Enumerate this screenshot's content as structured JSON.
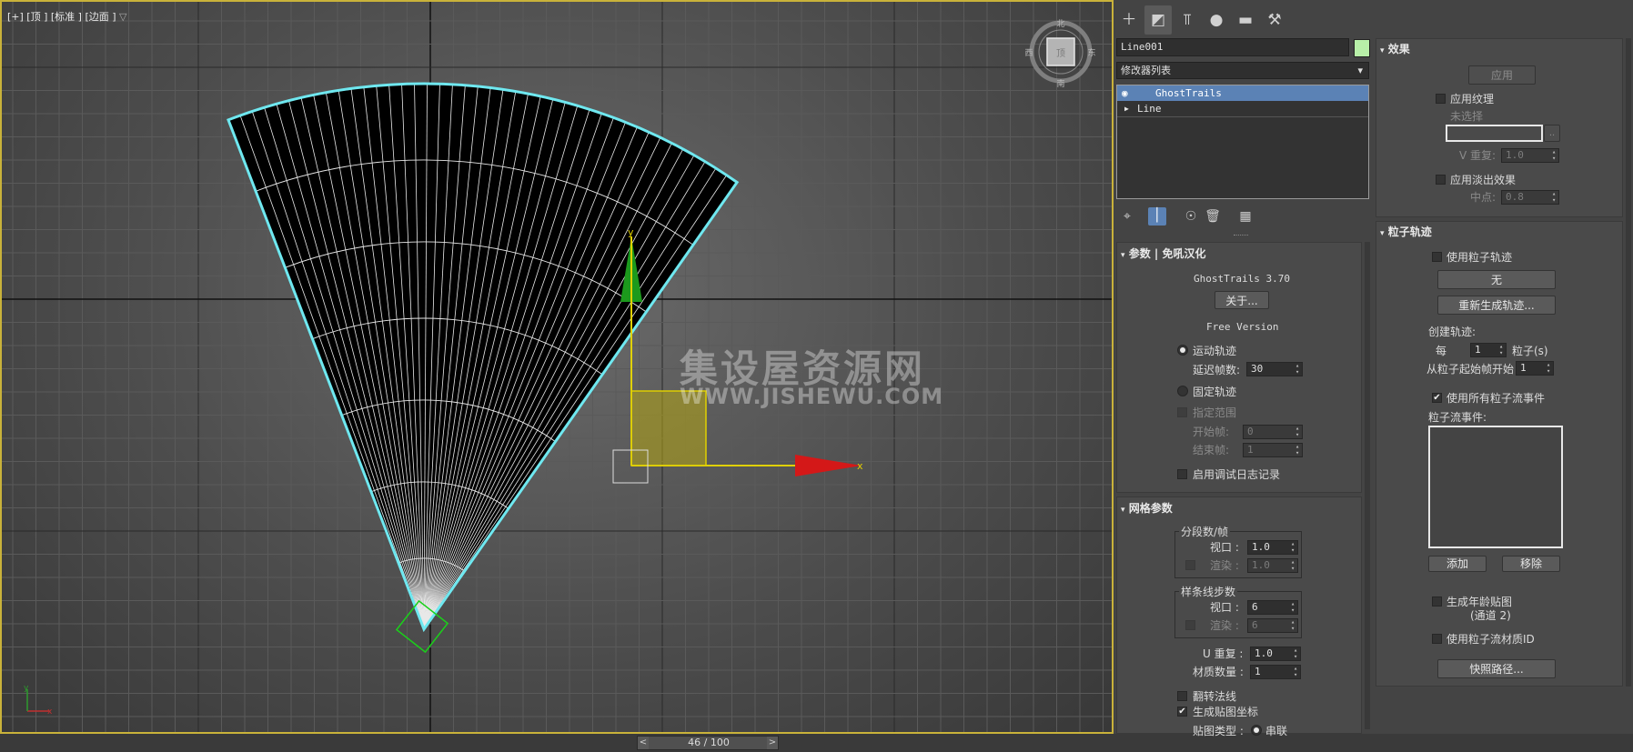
{
  "viewport": {
    "label": "[+] [顶 ] [标准 ] [边面 ]",
    "filter_icon": "filter-icon",
    "viewcube": {
      "top": "北",
      "left": "西",
      "right": "东",
      "bottom": "南",
      "face": "顶"
    },
    "axis_labels": {
      "x": "x",
      "y": "y"
    },
    "watermark_cn": "集设屋资源网",
    "watermark_url": "WWW.JISHEWU.COM"
  },
  "timebar": {
    "frame_text": "46 / 100",
    "prev": "<",
    "next": ">"
  },
  "command_tabs": [
    "create-icon",
    "modify-icon",
    "hierarchy-icon",
    "motion-icon",
    "display-icon",
    "utilities-icon"
  ],
  "object": {
    "name": "Line001",
    "color": "#b8f0a8"
  },
  "modifier_list": {
    "label": "修改器列表",
    "arrow": "▾"
  },
  "stack": {
    "items": [
      {
        "label": "GhostTrails",
        "selected": true
      },
      {
        "label": "Line",
        "selected": false
      }
    ]
  },
  "stack_tools": [
    "pin-icon",
    "show-end-result-icon",
    "make-unique-icon",
    "remove-modifier-icon",
    "configure-icon"
  ],
  "params": {
    "header": "参数 | 免吼汉化",
    "version": "GhostTrails 3.70",
    "about_btn": "关于...",
    "edition": "Free Version",
    "motion_trail": "运动轨迹",
    "delay_frames_label": "延迟帧数:",
    "delay_frames_value": "30",
    "fixed_trail": "固定轨迹",
    "specify_range": "指定范围",
    "start_frame_label": "开始帧:",
    "start_frame_value": "0",
    "end_frame_label": "结束帧:",
    "end_frame_value": "1",
    "debug_log": "启用调试日志记录"
  },
  "mesh": {
    "header": "网格参数",
    "segments_group": "分段数/帧",
    "viewport_label": "视口 :",
    "viewport_segments": "1.0",
    "render_label": "渲染 :",
    "render_segments": "1.0",
    "spline_group": "样条线步数",
    "spline_viewport": "6",
    "spline_render": "6",
    "u_repeat_label": "U 重复 :",
    "u_repeat_value": "1.0",
    "mat_count_label": "材质数量 :",
    "mat_count_value": "1",
    "flip_normals": "翻转法线",
    "gen_mapping": "生成贴图坐标",
    "map_type_label": "贴图类型 :",
    "map_type_value": "串联"
  },
  "effects": {
    "header": "效果",
    "apply_btn": "应用",
    "apply_texture": "应用纹理",
    "none_selected": "未选择",
    "v_repeat_label": "V 重复:",
    "v_repeat_value": "1.0",
    "apply_fade": "应用淡出效果",
    "midpoint_label": "中点:",
    "midpoint_value": "0.8"
  },
  "particles": {
    "header": "粒子轨迹",
    "use_particle_trail": "使用粒子轨迹",
    "none_btn": "无",
    "regen_btn": "重新生成轨迹...",
    "create_trail_label": "创建轨迹:",
    "every_label": "每",
    "every_value": "1",
    "particles_unit": "粒子(s)",
    "start_from_label": "从粒子起始帧开始",
    "start_from_value": "1",
    "use_all_events": "使用所有粒子流事件",
    "events_label": "粒子流事件:",
    "add_btn": "添加",
    "remove_btn": "移除",
    "gen_age_map": "生成年龄贴图",
    "channel_label": "(通道 2)",
    "use_mat_id": "使用粒子流材质ID",
    "snapshot_btn": "快照路径..."
  },
  "colors": {
    "selection_cyan": "#6fe8f0",
    "gizmo_green": "#1ad11a",
    "axis_x": "#d41818",
    "axis_y": "#1c9a1c",
    "frame_yellow": "#c9b23a"
  }
}
